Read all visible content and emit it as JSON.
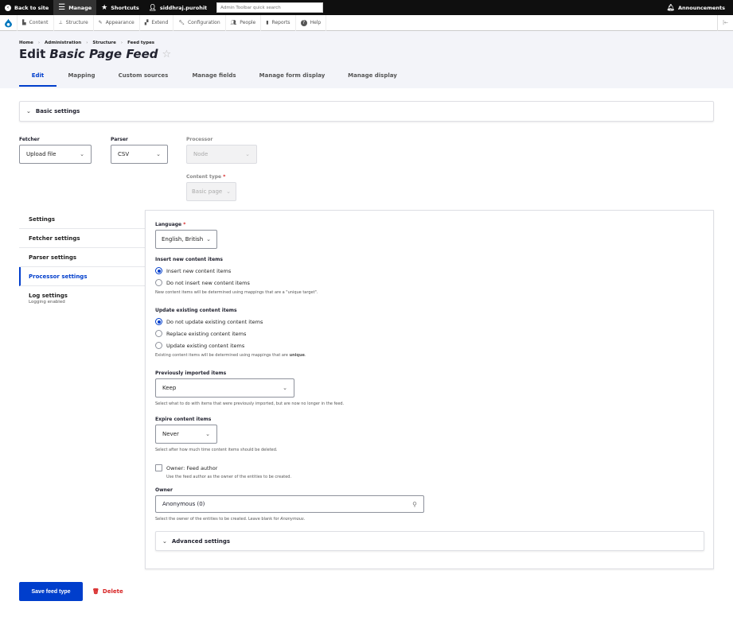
{
  "toolbar": {
    "back_to_site": "Back to site",
    "manage": "Manage",
    "shortcuts": "Shortcuts",
    "user": "siddhraj.purohit",
    "search_placeholder": "Admin Toolbar quick search",
    "announcements": "Announcements"
  },
  "tray": {
    "items": [
      {
        "label": "Content",
        "icon": "file-icon"
      },
      {
        "label": "Structure",
        "icon": "sitemap-icon"
      },
      {
        "label": "Appearance",
        "icon": "brush-icon"
      },
      {
        "label": "Extend",
        "icon": "puzzle-icon"
      },
      {
        "label": "Configuration",
        "icon": "wrench-icon"
      },
      {
        "label": "People",
        "icon": "people-icon"
      },
      {
        "label": "Reports",
        "icon": "bar-chart-icon"
      },
      {
        "label": "Help",
        "icon": "help-icon"
      }
    ],
    "collapse": "|←"
  },
  "breadcrumb": [
    "Home",
    "Administration",
    "Structure",
    "Feed types"
  ],
  "title": {
    "prefix": "Edit",
    "name": "Basic Page Feed",
    "star": "☆"
  },
  "tabs": [
    "Edit",
    "Mapping",
    "Custom sources",
    "Manage fields",
    "Manage form display",
    "Manage display"
  ],
  "basic_settings": {
    "summary": "Basic settings",
    "fetcher": {
      "label": "Fetcher",
      "value": "Upload file"
    },
    "parser": {
      "label": "Parser",
      "value": "CSV"
    },
    "processor": {
      "label": "Processor",
      "value": "Node"
    },
    "content_type": {
      "label": "Content type",
      "value": "Basic page",
      "required": "*"
    }
  },
  "vertical_tabs": [
    {
      "label": "Settings"
    },
    {
      "label": "Fetcher settings"
    },
    {
      "label": "Parser settings"
    },
    {
      "label": "Processor settings"
    },
    {
      "label": "Log settings",
      "summary": "Logging enabled"
    }
  ],
  "processor_settings": {
    "language": {
      "label": "Language",
      "required": "*",
      "value": "English, British"
    },
    "insert": {
      "label": "Insert new content items",
      "options": [
        "Insert new content items",
        "Do not insert new content items"
      ],
      "selected": 0,
      "desc": "New content items will be determined using mappings that are a \"unique target\"."
    },
    "update": {
      "label": "Update existing content items",
      "options": [
        "Do not update existing content items",
        "Replace existing content items",
        "Update existing content items"
      ],
      "selected": 0,
      "desc_prefix": "Existing content items will be determined using mappings that are ",
      "desc_bold": "unique",
      "desc_suffix": "."
    },
    "previously_imported": {
      "label": "Previously imported items",
      "value": "Keep",
      "desc": "Select what to do with items that were previously imported, but are now no longer in the feed."
    },
    "expire": {
      "label": "Expire content items",
      "value": "Never",
      "desc": "Select after how much time content items should be deleted."
    },
    "owner_feed_author": {
      "label": "Owner: Feed author",
      "checked": false,
      "desc": "Use the feed author as the owner of the entities to be created."
    },
    "owner": {
      "label": "Owner",
      "value": "Anonymous (0)",
      "desc_prefix": "Select the owner of the entities to be created. Leave blank for ",
      "desc_em": "Anonymous",
      "desc_suffix": "."
    },
    "advanced": "Advanced settings"
  },
  "actions": {
    "save": "Save feed type",
    "delete": "Delete"
  },
  "colors": {
    "accent": "#003ecc",
    "danger": "#d72222",
    "toolbar_bg": "#0f0f0f"
  }
}
